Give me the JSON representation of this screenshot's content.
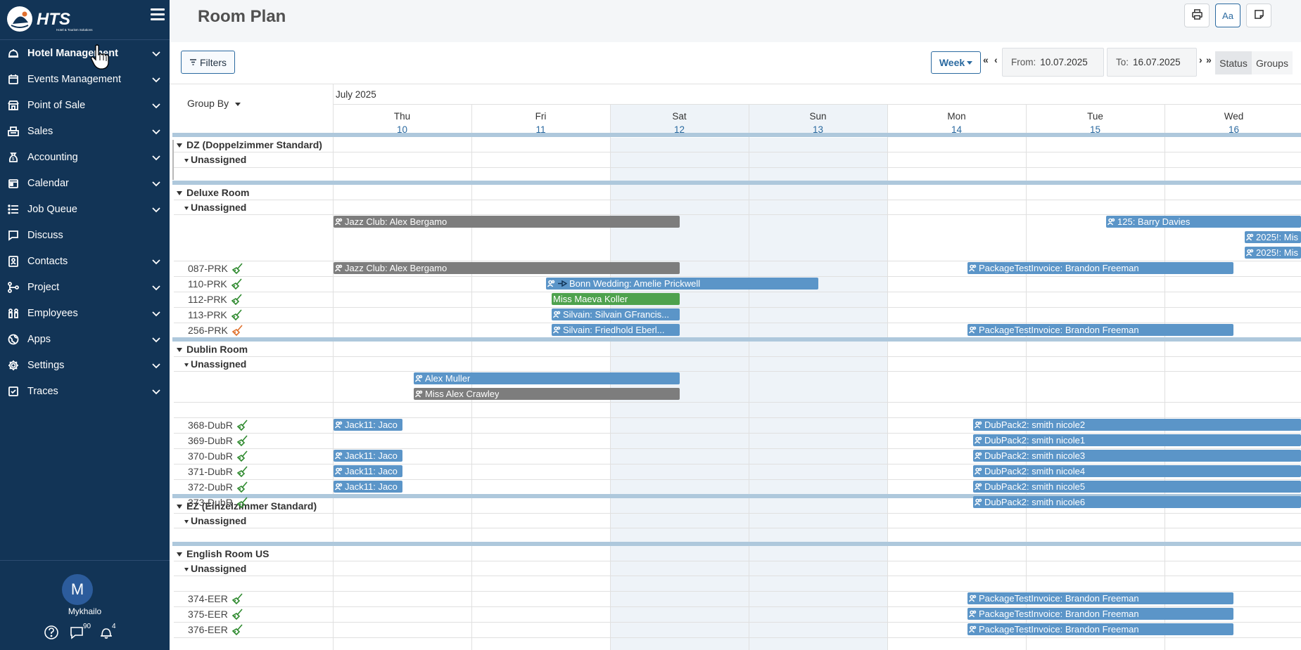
{
  "app": {
    "title": "Room Plan",
    "logo_text": "HTS",
    "logo_subtext": "Hotel & Tourism Solutions"
  },
  "sidebar": {
    "items": [
      {
        "label": "Hotel Management",
        "icon": "bell-icon",
        "chevron": true
      },
      {
        "label": "Events Management",
        "icon": "calendar-icon",
        "chevron": true
      },
      {
        "label": "Point of Sale",
        "icon": "store-icon",
        "chevron": true
      },
      {
        "label": "Sales",
        "icon": "register-icon",
        "chevron": true
      },
      {
        "label": "Accounting",
        "icon": "money-bag-icon",
        "chevron": true
      },
      {
        "label": "Calendar",
        "icon": "calendar-icon",
        "chevron": true
      },
      {
        "label": "Job Queue",
        "icon": "list-icon",
        "chevron": true
      },
      {
        "label": "Discuss",
        "icon": "chat-icon",
        "chevron": false
      },
      {
        "label": "Contacts",
        "icon": "contact-card-icon",
        "chevron": true
      },
      {
        "label": "Project",
        "icon": "hierarchy-icon",
        "chevron": true
      },
      {
        "label": "Employees",
        "icon": "people-icon",
        "chevron": true
      },
      {
        "label": "Apps",
        "icon": "globe-icon",
        "chevron": true
      },
      {
        "label": "Settings",
        "icon": "gear-icon",
        "chevron": true
      },
      {
        "label": "Traces",
        "icon": "checkbox-icon",
        "chevron": true
      }
    ],
    "user": {
      "initial": "M",
      "name": "Mykhailo"
    },
    "messages_count": "90",
    "notifications_count": "4"
  },
  "toolbar": {
    "filters_label": "Filters",
    "period_label": "Week",
    "first_label": "«",
    "prev_label": "‹",
    "next_label": "›",
    "last_label": "»",
    "from_label": "From:",
    "from_value": "10.07.2025",
    "to_label": "To:",
    "to_value": "16.07.2025",
    "mode_status": "Status",
    "mode_groups": "Groups",
    "font_button": "Aa"
  },
  "grid": {
    "group_by_label": "Group By",
    "month_label": "July 2025",
    "days": [
      {
        "name": "Thu",
        "num": "10"
      },
      {
        "name": "Fri",
        "num": "11"
      },
      {
        "name": "Sat",
        "num": "12"
      },
      {
        "name": "Sun",
        "num": "13"
      },
      {
        "name": "Mon",
        "num": "14"
      },
      {
        "name": "Tue",
        "num": "15"
      },
      {
        "name": "Wed",
        "num": "16"
      }
    ],
    "groups": [
      {
        "name": "DZ (Doppelzimmer Standard)",
        "sub": "Unassigned"
      },
      {
        "name": "Deluxe Room",
        "sub": "Unassigned"
      },
      {
        "name": "Dublin Room",
        "sub": "Unassigned"
      },
      {
        "name": "EZ (Einzelzimmer Standard)",
        "sub": "Unassigned"
      },
      {
        "name": "English Room US",
        "sub": "Unassigned"
      }
    ],
    "rooms": [
      "087-PRK",
      "110-PRK",
      "112-PRK",
      "113-PRK",
      "256-PRK",
      "368-DubR",
      "369-DubR",
      "370-DubR",
      "371-DubR",
      "372-DubR",
      "373-DubR",
      "374-EER",
      "375-EER",
      "376-EER"
    ],
    "bookings": [
      "Jazz Club: Alex Bergamo",
      "125: Barry Davies",
      "2025!: Mis",
      "2025!: Mis",
      "Jazz Club: Alex Bergamo",
      "PackageTestInvoice: Brandon Freeman",
      "Bonn Wedding: Amelie Prickwell",
      "Miss Maeva Koller",
      "Silvain: Silvain GFrancis...",
      "Silvain: Friedhold Eberl...",
      "PackageTestInvoice: Brandon Freeman",
      "Alex Muller",
      "Miss Alex Crawley",
      "Jack11: Jaco",
      "DubPack2: smith nicole2",
      "DubPack2: smith nicole1",
      "Jack11: Jaco",
      "DubPack2: smith nicole3",
      "Jack11: Jaco",
      "DubPack2: smith nicole4",
      "Jack11: Jaco",
      "DubPack2: smith nicole5",
      "DubPack2: smith nicole6",
      "PackageTestInvoice: Brandon Freeman",
      "PackageTestInvoice: Brandon Freeman",
      "PackageTestInvoice: Brandon Freeman"
    ]
  },
  "colors": {
    "sidebar_bg": "#123456",
    "booking_blue": "#5b95c8",
    "booking_gray": "#7d7d7d",
    "booking_green": "#4ea24e",
    "clean_ok": "#2f8a2f",
    "clean_dirty": "#e0702a"
  }
}
